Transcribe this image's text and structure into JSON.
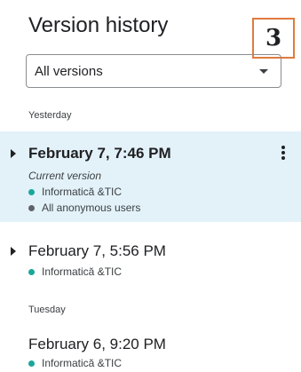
{
  "header": {
    "title": "Version history",
    "badge": "3"
  },
  "filter": {
    "selected": "All versions",
    "icon": "chevron-down-icon"
  },
  "sections": [
    {
      "label": "Yesterday"
    },
    {
      "label": "Tuesday"
    }
  ],
  "versions": [
    {
      "date": "February 7, 7:46 PM",
      "current_label": "Current version",
      "users": [
        {
          "name": "Informatică &TIC",
          "color": "#1aa79a"
        },
        {
          "name": "All anonymous users",
          "color": "#5f6368"
        }
      ]
    },
    {
      "date": "February 7, 5:56 PM",
      "users": [
        {
          "name": "Informatică &TIC",
          "color": "#1aa79a"
        }
      ]
    },
    {
      "date": "February 6, 9:20 PM",
      "users": [
        {
          "name": "Informatică &TIC",
          "color": "#1aa79a"
        }
      ]
    }
  ],
  "colors": {
    "selected_bg": "#e3f2f9",
    "accent_badge_border": "#e07b3f"
  }
}
